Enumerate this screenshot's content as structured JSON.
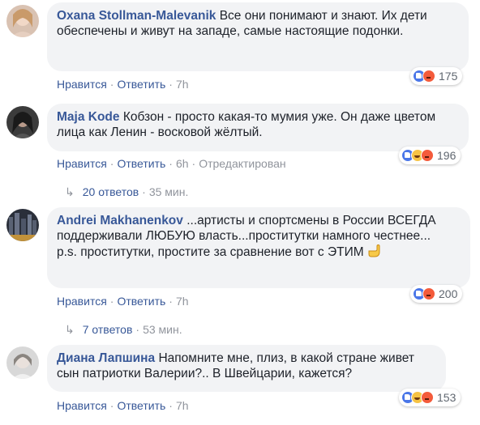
{
  "labels": {
    "like": "Нравится",
    "reply": "Ответить",
    "sep": "·"
  },
  "comments": [
    {
      "author": "Oxana Stollman-Malevanik",
      "text": "Все они понимают и знают. Их дети обеспечены и живут на западе, самые настоящие подонки.",
      "time": "7h",
      "edited": "",
      "reactions": "175",
      "reaction_types": [
        "like",
        "angry"
      ]
    },
    {
      "author": "Maja Kode",
      "text": "Кобзон - просто какая-то мумия уже. Он даже цветом лица как Ленин - восковой жёлтый.",
      "time": "6h",
      "edited": "Отредактирован",
      "reactions": "196",
      "reaction_types": [
        "like",
        "haha",
        "angry"
      ],
      "replies": {
        "count": "20 ответов",
        "time": "35 мин."
      }
    },
    {
      "author": "Andrei Makhanenkov",
      "text": "...артисты и спортсмены в России ВСЕГДА поддерживали ЛЮБУЮ власть...проститутки намного честнее...",
      "text2": "p.s. проститутки, простите за сравнение вот с ЭТИМ",
      "time": "7h",
      "edited": "",
      "reactions": "200",
      "reaction_types": [
        "like",
        "angry"
      ],
      "replies": {
        "count": "7 ответов",
        "time": "53 мин."
      }
    },
    {
      "author": "Диана Лапшина",
      "text": "Напомните мне, плиз, в какой стране живет сын патриотки Валерии?.. В Швейцарии, кажется?",
      "time": "7h",
      "edited": "",
      "reactions": "153",
      "reaction_types": [
        "like",
        "haha",
        "angry"
      ]
    }
  ]
}
